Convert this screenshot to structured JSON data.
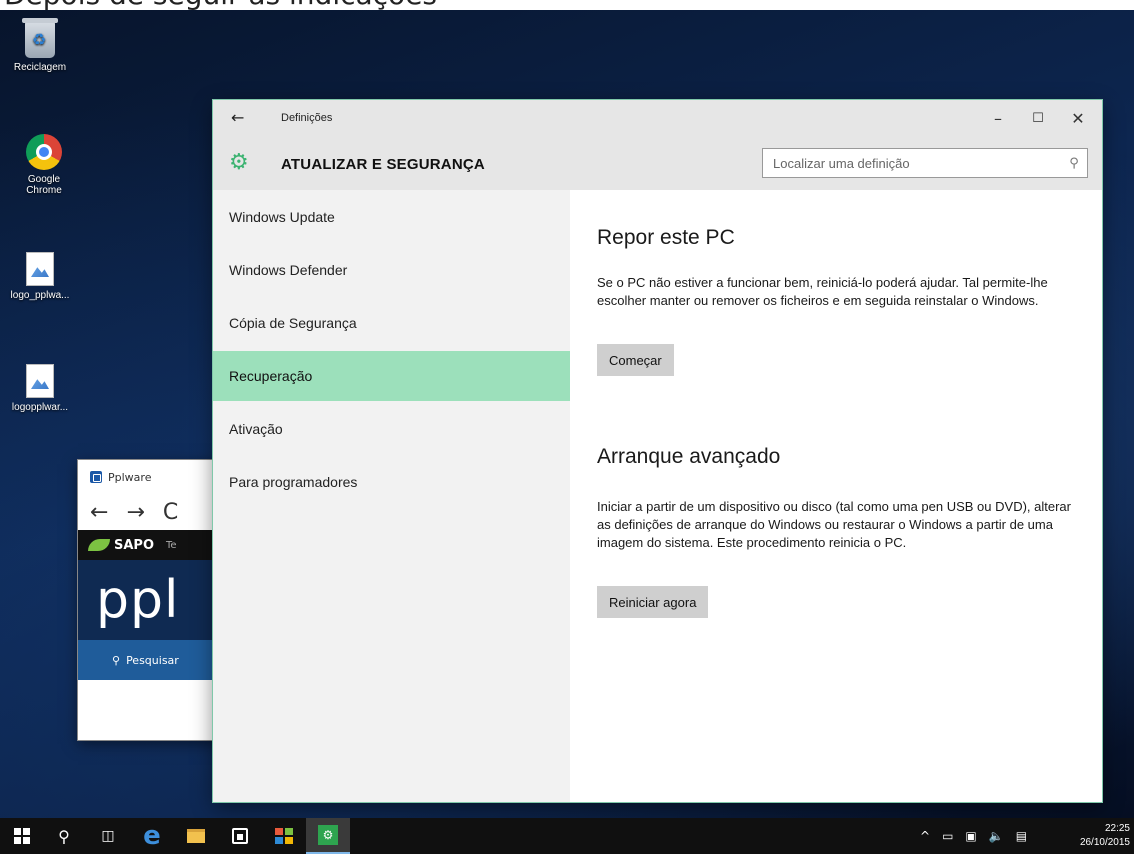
{
  "caption": "Depois de seguir as indicações",
  "desktop": {
    "icons": [
      {
        "label": "Reciclagem"
      },
      {
        "label": "Google Chrome"
      },
      {
        "label": "logo_pplwa..."
      },
      {
        "label": "logopplwar..."
      }
    ]
  },
  "browser": {
    "tab_title": "Pplware",
    "back_glyph": "←",
    "forward_glyph": "→",
    "reload_glyph": "C",
    "sapo_label": "SAPO",
    "sapo_suffix": "Te",
    "hero_text": "ppl",
    "search_label": "Pesquisar"
  },
  "settings": {
    "window_title": "Definições",
    "section_title": "ATUALIZAR E SEGURANÇA",
    "search_placeholder": "Localizar uma definição",
    "nav_items": [
      {
        "label": "Windows Update"
      },
      {
        "label": "Windows Defender"
      },
      {
        "label": "Cópia de Segurança"
      },
      {
        "label": "Recuperação",
        "selected": true
      },
      {
        "label": "Ativação"
      },
      {
        "label": "Para programadores"
      }
    ],
    "content": {
      "reset": {
        "heading": "Repor este PC",
        "text": "Se o PC não estiver a funcionar bem, reiniciá-lo poderá ajudar. Tal permite-lhe escolher manter ou remover os ficheiros e em seguida reinstalar o Windows.",
        "button": "Começar"
      },
      "advanced": {
        "heading": "Arranque avançado",
        "text": "Iniciar a partir de um dispositivo ou disco (tal como uma pen USB ou DVD), alterar as definições de arranque do Windows ou restaurar o Windows a partir de uma imagem do sistema. Este procedimento reinicia o PC.",
        "button": "Reiniciar agora"
      }
    },
    "window_buttons": {
      "minimize": "–",
      "maximize": "☐",
      "close": "✕"
    }
  },
  "taskbar": {
    "clock_time": "22:25",
    "clock_date": "26/10/2015"
  },
  "colors": {
    "accent": "#9ce0bb",
    "settings_icon": "#3cb371",
    "taskbar": "#101010"
  }
}
